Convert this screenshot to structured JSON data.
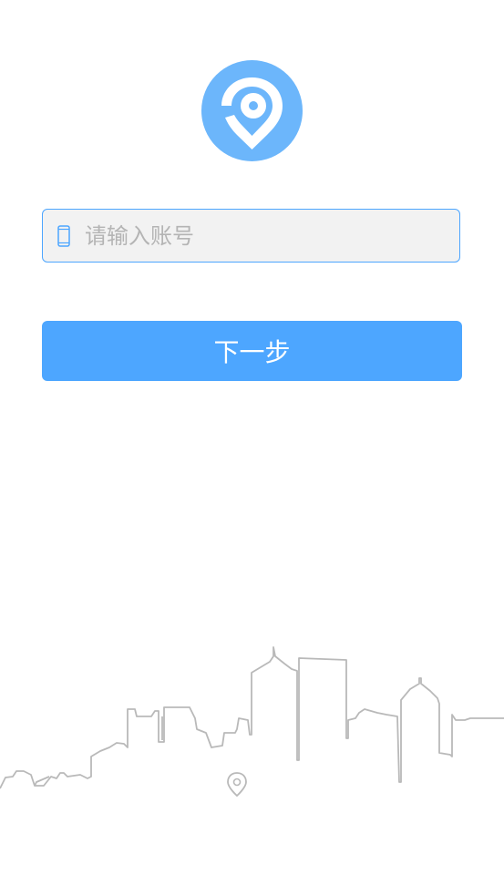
{
  "login": {
    "logo_icon": "location-pin-logo-icon",
    "account_field": {
      "icon": "phone-icon",
      "placeholder": "请输入账号",
      "value": ""
    },
    "next_button_label": "下一步"
  },
  "background": {
    "illustration": "city-skyline-illustration",
    "pin_icon": "location-pin-icon"
  },
  "colors": {
    "accent": "#4da6ff",
    "logo": "#6cb6fb",
    "field_bg": "#f2f2f2",
    "placeholder": "#b4b4b4",
    "skyline": "#b9b9b9"
  }
}
